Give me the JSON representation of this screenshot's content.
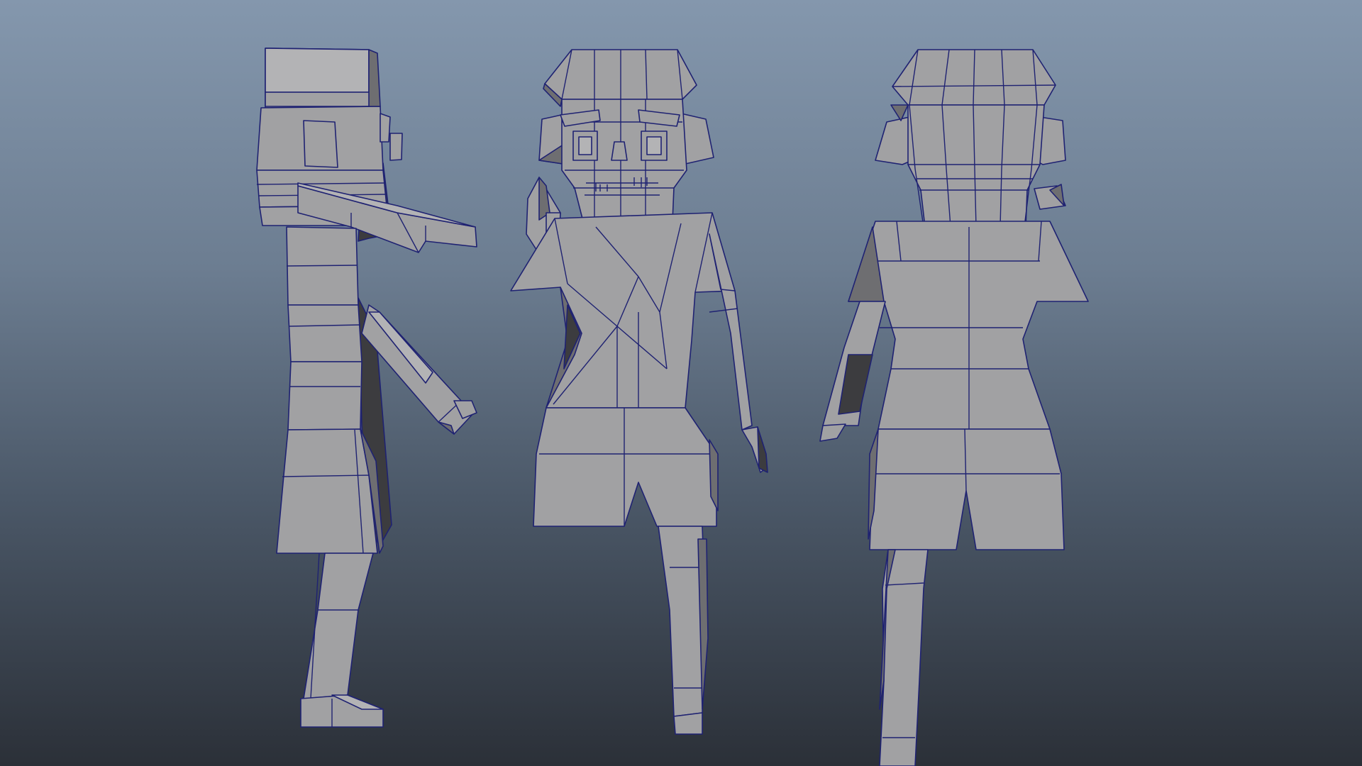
{
  "viewport": {
    "views": [
      {
        "name": "side-view"
      },
      {
        "name": "front-view"
      },
      {
        "name": "back-view"
      }
    ]
  },
  "colors": {
    "background_top": "#8497ad",
    "background_bottom": "#2b3038",
    "mesh_face": "#a1a1a3",
    "mesh_wireframe": "#1f2272",
    "mesh_shadow": "#6e6e71"
  }
}
